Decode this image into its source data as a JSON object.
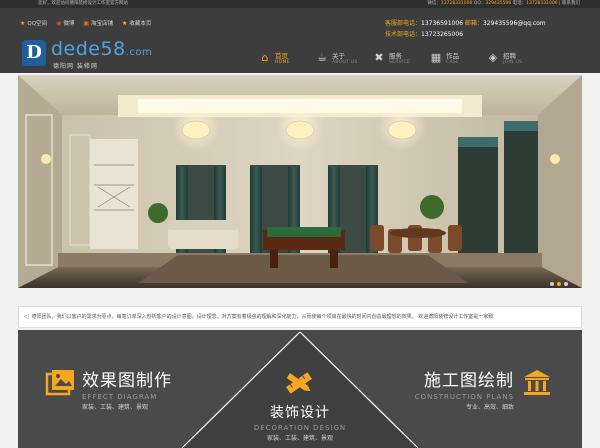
{
  "topbar": {
    "welcome": "您好，欢迎访问德阳装修设计工作室官方网站",
    "contact_pre": "微信：",
    "wechat": "13728331006",
    "qq_pre": " QQ：",
    "qq": "329435596",
    "tel_pre": " 电话：",
    "tel": "13728331006",
    "suffix": " | 联系我们"
  },
  "quicklinks": [
    {
      "icon": "qq-icon",
      "label": "QQ空间"
    },
    {
      "icon": "weibo-icon",
      "label": "微博"
    },
    {
      "icon": "taobao-icon",
      "label": "淘宝店铺"
    },
    {
      "icon": "star-icon",
      "label": "收藏本页"
    }
  ],
  "logo": {
    "badge": "D",
    "word": "dede",
    "num": "58",
    "com": ".com",
    "sub": "德阳网 装修网"
  },
  "hotline": {
    "l1_label": "客服部电话：",
    "l1_num": "13736591006",
    "l1_mail_label": "  邮箱：",
    "l1_mail": "329435596@qq.com",
    "l2_label": "技术部电话：",
    "l2_num": "13723265006"
  },
  "nav": [
    {
      "icon": "home-icon",
      "glyph": "⌂",
      "cn": "首页",
      "en": "HOME",
      "active": true
    },
    {
      "icon": "coffee-icon",
      "glyph": "☕",
      "cn": "关于",
      "en": "ABOUT US",
      "active": false
    },
    {
      "icon": "tools-icon",
      "glyph": "✖",
      "cn": "服务",
      "en": "SERVICE",
      "active": false
    },
    {
      "icon": "gallery-icon",
      "glyph": "▦",
      "cn": "作品",
      "en": "CASE",
      "active": false
    },
    {
      "icon": "layers-icon",
      "glyph": "◈",
      "cn": "招聘",
      "en": "JOIN US",
      "active": false
    }
  ],
  "slider": {
    "count": 3,
    "active": 1
  },
  "notice": "德阳团队，我们以客户的需求为原点，每笔订单深入剖析客户的设计意图，设计理念，对方案有着极强的理解和深化能力，从而使每个项目在最快的时间内创造最理想的效果。  欢迎德阳装修设计工作室是一家致",
  "services": [
    {
      "title": "效果图制作",
      "en": "EFFECT DIAGRAM",
      "keys": "家装、工装、建筑、景观",
      "icon": "image-frame-icon"
    },
    {
      "title": "装饰设计",
      "en": "DECORATION DESIGN",
      "keys": "家装、工装、建筑、景观",
      "icon": "pencil-ruler-icon"
    },
    {
      "title": "施工图绘制",
      "en": "CONSTRUCTION PLANS",
      "keys": "专业、高效、细致",
      "icon": "bank-building-icon"
    }
  ],
  "colors": {
    "accent": "#f5a623",
    "header": "#3d3d3d",
    "topbar": "#2e2e2e",
    "services": "#4a4a4a"
  }
}
